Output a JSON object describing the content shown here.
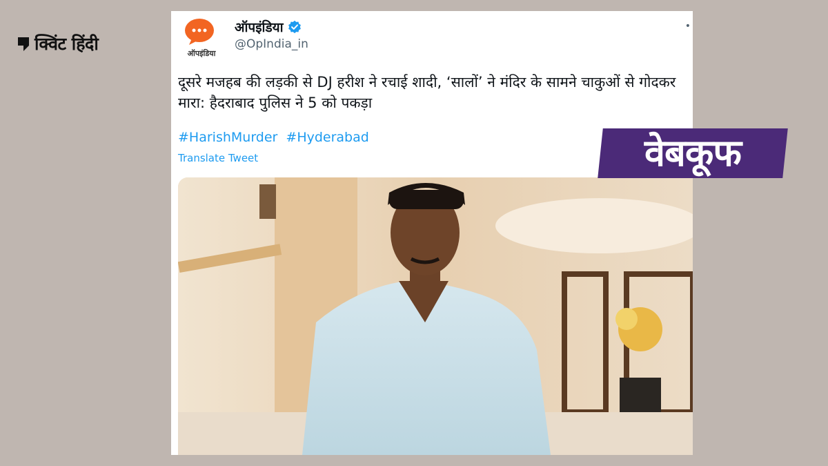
{
  "brand": {
    "name": "क्विंट हिंदी"
  },
  "tweet": {
    "avatar_label": "ऑपइंडिया",
    "display_name": "ऑपइंडिया",
    "handle": "@OpIndia_in",
    "text": "दूसरे मजहब की लड़की से DJ हरीश ने रचाई शादी, ‘सालों’ ने मंदिर के सामने चाकुओं से गोदकर मारा: हैदराबाद पुलिस ने 5 को पकड़ा",
    "hashtags": [
      "#HarishMurder",
      "#Hyderabad"
    ],
    "translate_label": "Translate Tweet",
    "more": "•"
  },
  "stamp": {
    "label": "वेबकूफ"
  },
  "icons": [
    "quint-logo-icon",
    "verified-badge-icon",
    "more-icon",
    "chat-bubble-icon"
  ],
  "colors": {
    "background": "#bfb6b0",
    "link": "#1d9bf0",
    "verified": "#1d9bf0",
    "stamp": "#4b2a78",
    "avatar": "#f26522"
  }
}
